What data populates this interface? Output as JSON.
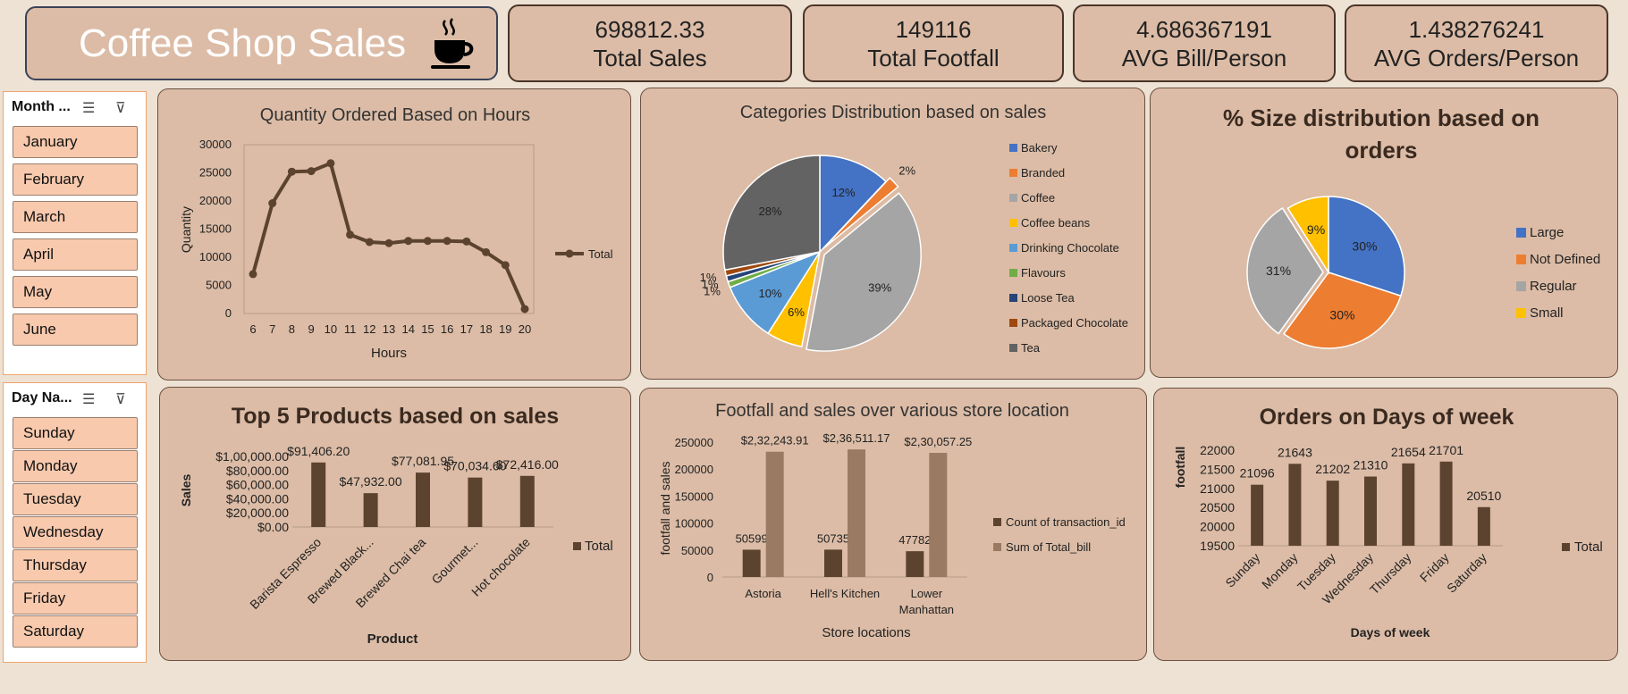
{
  "header": {
    "title": "Coffee Shop Sales",
    "icon": "coffee-cup-icon"
  },
  "kpis": [
    {
      "value": "698812.33",
      "label": "Total Sales"
    },
    {
      "value": "149116",
      "label": "Total Footfall"
    },
    {
      "value": "4.686367191",
      "label": "AVG Bill/Person"
    },
    {
      "value": "1.438276241",
      "label": "AVG Orders/Person"
    }
  ],
  "slicers": {
    "month": {
      "header": "Month ...",
      "items": [
        "January",
        "February",
        "March",
        "April",
        "May",
        "June"
      ]
    },
    "day": {
      "header": "Day Na...",
      "items": [
        "Sunday",
        "Monday",
        "Tuesday",
        "Wednesday",
        "Thursday",
        "Friday",
        "Saturday"
      ]
    }
  },
  "colors": {
    "brown": "#5c4330",
    "brown_light": "#9a7a62",
    "card": "#dcbca6"
  },
  "chart_data": [
    {
      "type": "line",
      "title": "Quantity Ordered Based on Hours",
      "xlabel": "Hours",
      "ylabel": "Quantity",
      "x": [
        6,
        7,
        8,
        9,
        10,
        11,
        12,
        13,
        14,
        15,
        16,
        17,
        18,
        19,
        20
      ],
      "series": [
        {
          "name": "Total",
          "values": [
            7000,
            19600,
            25200,
            25300,
            26700,
            14000,
            12700,
            12500,
            12900,
            12900,
            12900,
            12800,
            10900,
            8600,
            800
          ]
        }
      ],
      "ylim": [
        0,
        30000
      ],
      "yticks": [
        0,
        5000,
        10000,
        15000,
        20000,
        25000,
        30000
      ],
      "legend": "right"
    },
    {
      "type": "pie",
      "title": "Categories Distribution based on sales",
      "slices": [
        {
          "label": "Bakery",
          "value": 12,
          "text": "12%",
          "color": "#4472c4"
        },
        {
          "label": "Branded",
          "value": 2,
          "text": "2%",
          "color": "#ed7d31"
        },
        {
          "label": "Coffee",
          "value": 39,
          "text": "39%",
          "color": "#a5a5a5"
        },
        {
          "label": "Coffee beans",
          "value": 6,
          "text": "6%",
          "color": "#ffc000"
        },
        {
          "label": "Drinking Chocolate",
          "value": 10,
          "text": "10%",
          "color": "#5b9bd5"
        },
        {
          "label": "Flavours",
          "value": 1,
          "text": "1%",
          "color": "#70ad47"
        },
        {
          "label": "Loose Tea",
          "value": 1,
          "text": "1%",
          "color": "#264478"
        },
        {
          "label": "Packaged Chocolate",
          "value": 1,
          "text": "1%",
          "color": "#9e480e"
        },
        {
          "label": "Tea",
          "value": 28,
          "text": "28%",
          "color": "#636363"
        }
      ],
      "legend": "right"
    },
    {
      "type": "pie",
      "title": "% Size distribution based on orders",
      "slices": [
        {
          "label": "Large",
          "value": 30,
          "text": "30%",
          "color": "#4472c4"
        },
        {
          "label": "Not Defined",
          "value": 30,
          "text": "30%",
          "color": "#ed7d31"
        },
        {
          "label": "Regular",
          "value": 31,
          "text": "31%",
          "color": "#a5a5a5"
        },
        {
          "label": "Small",
          "value": 9,
          "text": "9%",
          "color": "#ffc000"
        }
      ],
      "legend": "right"
    },
    {
      "type": "bar",
      "title": "Top 5 Products based on sales",
      "xlabel": "Product",
      "ylabel": "Sales",
      "categories": [
        "Barista Espresso",
        "Brewed Black...",
        "Brewed Chai tea",
        "Gourmet...",
        "Hot chocolate"
      ],
      "series": [
        {
          "name": "Total",
          "values": [
            91406.2,
            47932.0,
            77081.95,
            70034.6,
            72416.0
          ]
        }
      ],
      "data_labels": [
        "$91,406.20",
        "$47,932.00",
        "$77,081.95",
        "$70,034.60",
        "$72,416.00"
      ],
      "ylim": [
        0,
        100000
      ],
      "ytick_labels": [
        "$0.00",
        "$20,000.00",
        "$40,000.00",
        "$60,000.00",
        "$80,000.00",
        "$1,00,000.00"
      ],
      "legend": "right"
    },
    {
      "type": "bar",
      "title": "Footfall and sales over various store location",
      "xlabel": "Store locations",
      "ylabel": "footfall and sales",
      "categories": [
        "Astoria",
        "Hell's Kitchen",
        "Lower Manhattan"
      ],
      "series": [
        {
          "name": "Count of transaction_id",
          "values": [
            50599,
            50735,
            47782
          ],
          "labels": [
            "50599",
            "50735",
            "47782"
          ]
        },
        {
          "name": "Sum of Total_bill",
          "values": [
            232243.91,
            236511.17,
            230057.25
          ],
          "labels": [
            "$2,32,243.91",
            "$2,36,511.17",
            "$2,30,057.25"
          ]
        }
      ],
      "ylim": [
        0,
        250000
      ],
      "yticks": [
        0,
        50000,
        100000,
        150000,
        200000,
        250000
      ],
      "legend": "right"
    },
    {
      "type": "bar",
      "title": "Orders on Days of week",
      "xlabel": "Days of week",
      "ylabel": "footfall",
      "categories": [
        "Sunday",
        "Monday",
        "Tuesday",
        "Wednesday",
        "Thursday",
        "Friday",
        "Saturday"
      ],
      "series": [
        {
          "name": "Total",
          "values": [
            21096,
            21643,
            21202,
            21310,
            21654,
            21701,
            20510
          ]
        }
      ],
      "ylim": [
        19500,
        22000
      ],
      "yticks": [
        19500,
        20000,
        20500,
        21000,
        21500,
        22000
      ],
      "legend": "right"
    }
  ]
}
